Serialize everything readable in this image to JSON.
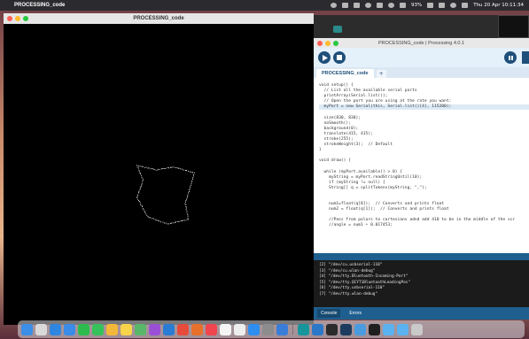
{
  "menubar": {
    "app_name": "PROCESSING_code",
    "battery": "93%",
    "datetime": "Thu 20 Apr  10:11:34"
  },
  "sketch_window": {
    "title": "PROCESSING_code"
  },
  "ide_window": {
    "title": "PROCESSING_code | Processing 4.0.1",
    "tab_label": "PROCESSING_code",
    "tab_add": "+",
    "run_icon": "play-icon",
    "stop_icon": "stop-icon",
    "code_lines": [
      {
        "text": "void setup() {",
        "hl": false
      },
      {
        "text": "  // List all the available serial ports",
        "hl": false
      },
      {
        "text": "  printArray(Serial.list());",
        "hl": false
      },
      {
        "text": "  // Open the port you are using at the rate you want:",
        "hl": false
      },
      {
        "text": "  myPort = new Serial(this, Serial.list()[4], 115200);",
        "hl": true
      },
      {
        "text": "",
        "hl": false
      },
      {
        "text": "  size(830, 830);",
        "hl": false
      },
      {
        "text": "  noSmooth();",
        "hl": false
      },
      {
        "text": "  background(0);",
        "hl": false
      },
      {
        "text": "  translate(415, 415);",
        "hl": false
      },
      {
        "text": "  stroke(255);",
        "hl": false
      },
      {
        "text": "  strokeWeight(3);  // Default",
        "hl": false
      },
      {
        "text": "}",
        "hl": false
      },
      {
        "text": "",
        "hl": false
      },
      {
        "text": "void draw() {",
        "hl": false
      },
      {
        "text": "",
        "hl": false
      },
      {
        "text": "  while (myPort.available() > 0) {",
        "hl": false
      },
      {
        "text": "    myString = myPort.readStringUntil(10);",
        "hl": false
      },
      {
        "text": "    if (myString != null) {",
        "hl": false
      },
      {
        "text": "    String[] q = splitTokens(myString, \",\");",
        "hl": false
      },
      {
        "text": "",
        "hl": false
      },
      {
        "text": "",
        "hl": false
      },
      {
        "text": "    num1=float(q[0]);  // Converts and prints float",
        "hl": false
      },
      {
        "text": "    num2 = float(q[1]);  // Converts and prints float",
        "hl": false
      },
      {
        "text": "",
        "hl": false
      },
      {
        "text": "    //Pass from polars to cartesians adnd add 410 to be in the middle of the scr",
        "hl": false
      },
      {
        "text": "    //angle = num1 + 0.017453;",
        "hl": false
      }
    ],
    "console_lines": [
      "[2] \"/dev/cu.usbserial-110\"",
      "[3] \"/dev/cu.wlan-debug\"",
      "[4] \"/dev/tty.Bluetooth-Incoming-Port\"",
      "[5] \"/dev/tty.QCYT1BluetoothLeadingPos\"",
      "[6] \"/dev/tty.usbserial-110\"",
      "[7] \"/dev/tty.wlan-debug\""
    ],
    "bottom_tabs": [
      "Console",
      "Errors"
    ]
  },
  "dock": {
    "icons": [
      {
        "name": "finder-icon",
        "color": "#3c8ee6"
      },
      {
        "name": "launchpad-icon",
        "color": "#d9d9d9"
      },
      {
        "name": "safari-icon",
        "color": "#2f86e0"
      },
      {
        "name": "mail-icon",
        "color": "#3a8ce8"
      },
      {
        "name": "facetime-icon",
        "color": "#2dbb4e"
      },
      {
        "name": "messages-icon",
        "color": "#36c25a"
      },
      {
        "name": "photos-icon",
        "color": "#f3b73a"
      },
      {
        "name": "notes-icon",
        "color": "#f7d44a"
      },
      {
        "name": "maps-icon",
        "color": "#59b76a"
      },
      {
        "name": "podcasts-icon",
        "color": "#9b4fd6"
      },
      {
        "name": "wifi-app-icon",
        "color": "#2a7bd4"
      },
      {
        "name": "chrome-icon",
        "color": "#e64b3c"
      },
      {
        "name": "firefox-icon",
        "color": "#e7702b"
      },
      {
        "name": "music-icon",
        "color": "#f0444f"
      },
      {
        "name": "calendar-icon",
        "color": "#f4f4f4"
      },
      {
        "name": "reminders-icon",
        "color": "#eeeeee"
      },
      {
        "name": "app-store-icon",
        "color": "#2d8ef0"
      },
      {
        "name": "settings-icon",
        "color": "#8c8c8c"
      },
      {
        "name": "preview-icon",
        "color": "#3a7dd8"
      },
      {
        "name": "arduino-icon",
        "color": "#17959c"
      },
      {
        "name": "vscode-icon",
        "color": "#2b78c8"
      },
      {
        "name": "quicktime-icon",
        "color": "#2b2b2b"
      },
      {
        "name": "processing-icon",
        "color": "#1d3b5e"
      },
      {
        "name": "files-icon",
        "color": "#4a9be0"
      },
      {
        "name": "terminal-icon",
        "color": "#1f1f1f"
      },
      {
        "name": "folder-icon",
        "color": "#5ab2f0"
      },
      {
        "name": "folder-icon-2",
        "color": "#5ab2f0"
      },
      {
        "name": "trash-icon",
        "color": "#c9c9c9"
      }
    ]
  },
  "plot": {
    "outline": [
      [
        -0.95,
        -1.0
      ],
      [
        -0.3,
        -0.85
      ],
      [
        0.25,
        -0.95
      ],
      [
        0.95,
        -0.75
      ],
      [
        0.8,
        -0.2
      ],
      [
        0.65,
        0.3
      ],
      [
        0.75,
        0.85
      ],
      [
        0.05,
        1.0
      ],
      [
        -0.6,
        0.75
      ],
      [
        -0.95,
        0.1
      ],
      [
        -0.75,
        -0.5
      ],
      [
        -0.95,
        -1.0
      ]
    ]
  }
}
